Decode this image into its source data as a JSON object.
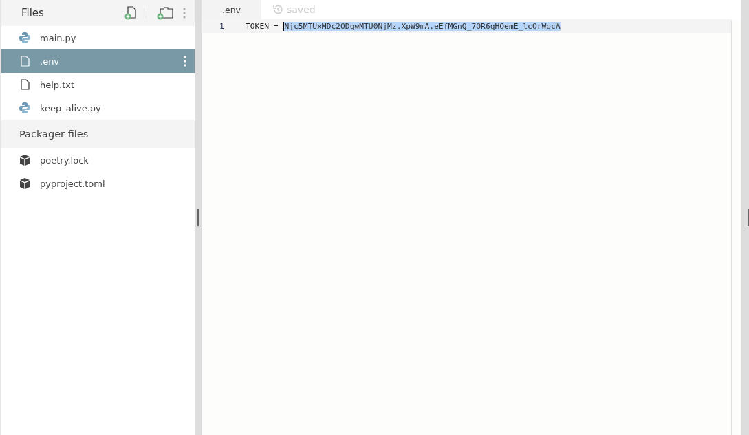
{
  "sidebar": {
    "title": "Files",
    "files": [
      {
        "name": "main.py",
        "kind": "python",
        "selected": false
      },
      {
        "name": ".env",
        "kind": "file",
        "selected": true
      },
      {
        "name": "help.txt",
        "kind": "file",
        "selected": false
      },
      {
        "name": "keep_alive.py",
        "kind": "python",
        "selected": false
      }
    ],
    "packager_title": "Packager files",
    "packager_files": [
      {
        "name": "poetry.lock",
        "kind": "package"
      },
      {
        "name": "pyproject.toml",
        "kind": "package"
      }
    ]
  },
  "editor": {
    "tab": ".env",
    "status": "saved",
    "lines": [
      {
        "number": "1",
        "key": "TOKEN = ",
        "selected_text": "Njc5MTUxMDc2ODgwMTU0NjMz.XpW9mA.eEfMGnQ_7OR6qHOemE_lcOrWocA"
      }
    ]
  }
}
